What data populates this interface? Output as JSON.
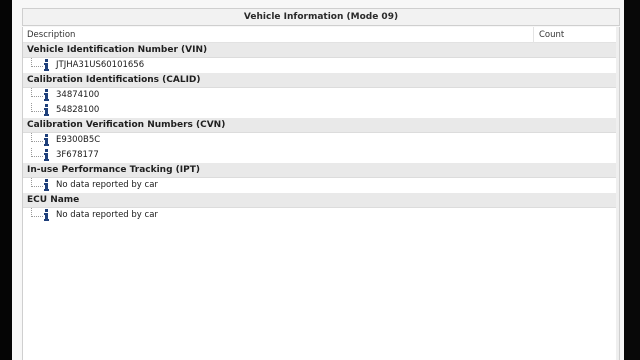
{
  "window": {
    "title": "Vehicle Information (Mode 09)"
  },
  "columns": {
    "description": "Description",
    "count": "Count"
  },
  "sections": [
    {
      "label": "Vehicle Identification Number (VIN)",
      "items": [
        "JTJHA31US60101656"
      ]
    },
    {
      "label": "Calibration Identifications (CALID)",
      "items": [
        "34874100",
        "54828100"
      ]
    },
    {
      "label": "Calibration Verification Numbers (CVN)",
      "items": [
        "E9300B5C",
        "3F678177"
      ]
    },
    {
      "label": "In-use Performance Tracking (IPT)",
      "items": [
        "No data reported by car"
      ]
    },
    {
      "label": "ECU Name",
      "items": [
        "No data reported by car"
      ]
    }
  ],
  "icons": {
    "row_icon": "info-icon",
    "tree_connector": "tree-branch-icon"
  },
  "colors": {
    "section_background": "#e9e9e9",
    "info_icon": "#1e3f7a"
  }
}
